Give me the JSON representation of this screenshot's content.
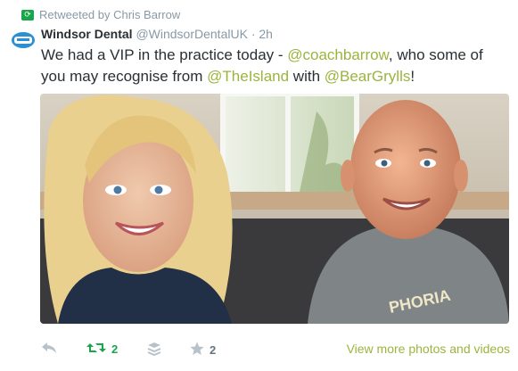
{
  "context": {
    "text": "Retweeted by Chris Barrow",
    "icon": "retweet-icon"
  },
  "tweet": {
    "name": "Windsor Dental",
    "handle": "@WindsorDentalUK",
    "separator": "·",
    "time": "2h",
    "text": {
      "part1": "We had a VIP in the practice today - ",
      "mention1": "@coachbarrow",
      "part2": ", who some of you may recognise from ",
      "mention2": "@TheIsland",
      "part3": " with ",
      "mention3": "@BearGrylls",
      "part4": "!"
    }
  },
  "actions": {
    "reply_icon": "reply-icon",
    "retweet_count": "2",
    "buffer_icon": "buffer-stack-icon",
    "favorite_count": "2",
    "view_more": "View more photos and videos"
  },
  "colors": {
    "mention": "#9bb43e",
    "retweet": "#19a54a",
    "muted": "#8899a6"
  }
}
